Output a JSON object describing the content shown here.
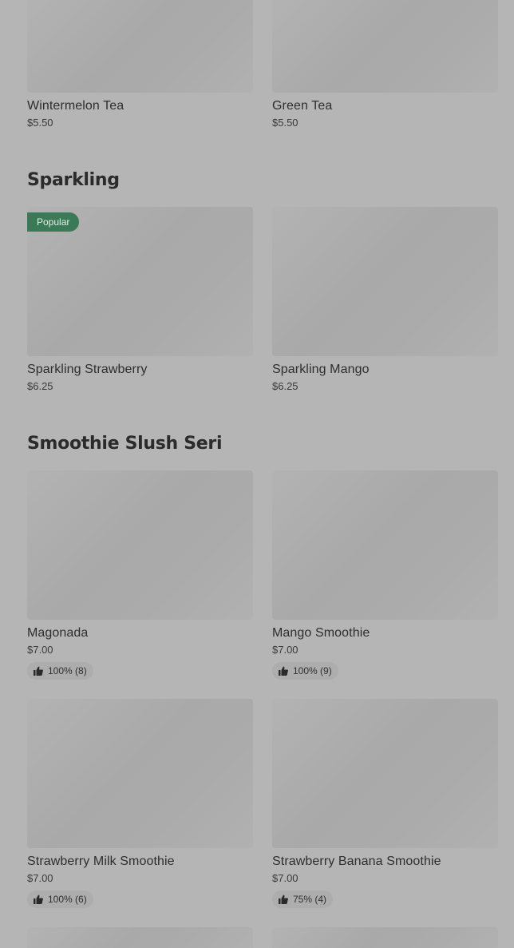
{
  "top_items": [
    {
      "name": "Wintermelon Tea",
      "price": "$5.50"
    },
    {
      "name": "Green Tea",
      "price": "$5.50"
    }
  ],
  "sparkling": {
    "title": "Sparkling",
    "items": [
      {
        "name": "Sparkling Strawberry",
        "price": "$6.25",
        "badge": "Popular"
      },
      {
        "name": "Sparkling Mango",
        "price": "$6.25"
      }
    ]
  },
  "smoothie": {
    "title": "Smoothie Slush Seri",
    "items": [
      {
        "name": "Magonada",
        "price": "$7.00",
        "rating": "100% (8)"
      },
      {
        "name": "Mango Smoothie",
        "price": "$7.00",
        "rating": "100% (9)"
      },
      {
        "name": "Strawberry Milk Smoothie",
        "price": "$7.00",
        "rating": "100% (6)"
      },
      {
        "name": "Strawberry Banana Smoothie",
        "price": "$7.00",
        "rating": "75% (4)"
      }
    ]
  },
  "icons": {
    "rating": "thumbs-up-icon"
  },
  "colors": {
    "background": "#b5b5b5",
    "image_placeholder": "#ababab",
    "popular_badge": "#3b7a57",
    "rating_pill": "#adadad",
    "text": "#2b2b2b"
  }
}
